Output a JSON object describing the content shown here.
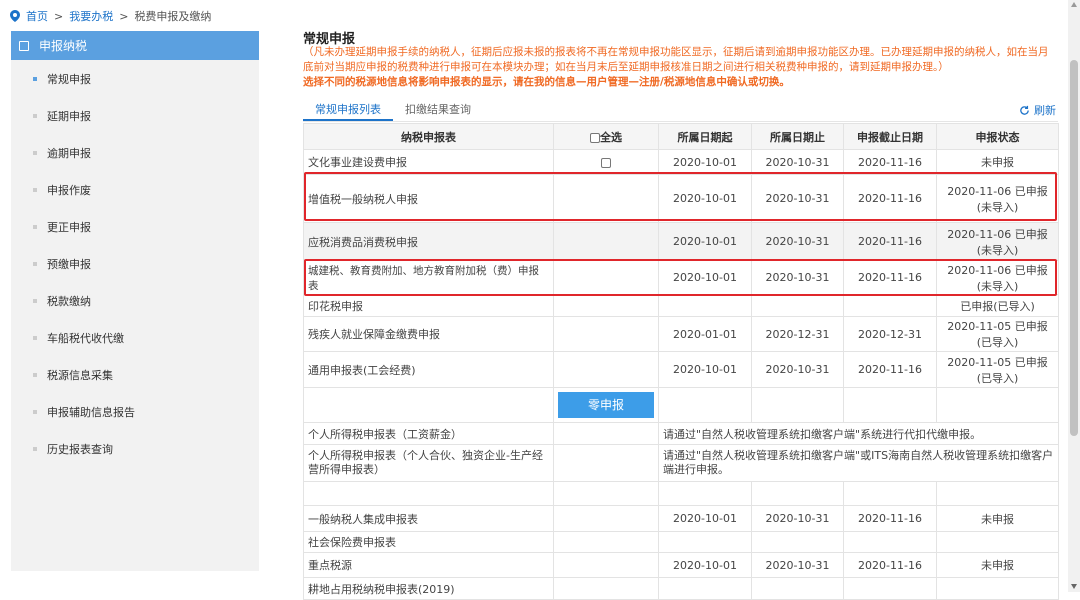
{
  "breadcrumb": {
    "home": "首页",
    "sep1": ">",
    "section": "我要办税",
    "sep2": ">",
    "current": "税费申报及缴纳"
  },
  "sidebar": {
    "header": "申报纳税",
    "items": [
      {
        "label": "常规申报",
        "active": true
      },
      {
        "label": "延期申报"
      },
      {
        "label": "逾期申报"
      },
      {
        "label": "申报作废"
      },
      {
        "label": "更正申报"
      },
      {
        "label": "预缴申报"
      },
      {
        "label": "税款缴纳"
      },
      {
        "label": "车船税代收代缴"
      },
      {
        "label": "税源信息采集"
      },
      {
        "label": "申报辅助信息报告"
      },
      {
        "label": "历史报表查询"
      }
    ]
  },
  "main": {
    "title": "常规申报",
    "notice": "（凡未办理延期申报手续的纳税人，征期后应报未报的报表将不再在常规申报功能区显示，征期后请到逾期申报功能区办理。已办理延期申报的纳税人，如在当月底前对当期应申报的税费种进行申报可在本模块办理；如在当月末后至延期申报核准日期之间进行相关税费种申报的，请到延期申报办理。）",
    "notice2": "选择不同的税源地信息将影响申报表的显示，请在我的信息—用户管理—注册/税源地信息中确认或切换。",
    "tabs": [
      "常规申报列表",
      "扣缴结果查询"
    ],
    "refresh": "刷新"
  },
  "table": {
    "headers": [
      "纳税申报表",
      "全选",
      "所属日期起",
      "所属日期止",
      "申报截止日期",
      "申报状态"
    ],
    "rows": [
      {
        "name": "文化事业建设费申报",
        "checkbox": true,
        "start": "2020-10-01",
        "end": "2020-10-31",
        "deadline": "2020-11-16",
        "status": "未申报"
      },
      {
        "name": "增值税一般纳税人申报",
        "start": "2020-10-01",
        "end": "2020-10-31",
        "deadline": "2020-11-16",
        "status": "2020-11-06 已申报(未导入)"
      },
      {
        "name": "应税消费品消费税申报",
        "start": "2020-10-01",
        "end": "2020-10-31",
        "deadline": "2020-11-16",
        "status": "2020-11-06 已申报(未导入)"
      },
      {
        "name": "城建税、教育费附加、地方教育附加税（费）申报表",
        "start": "2020-10-01",
        "end": "2020-10-31",
        "deadline": "2020-11-16",
        "status": "2020-11-06 已申报(未导入)"
      },
      {
        "name": "印花税申报",
        "start": "",
        "end": "",
        "deadline": "",
        "status": "已申报(已导入)"
      },
      {
        "name": "残疾人就业保障金缴费申报",
        "start": "2020-01-01",
        "end": "2020-12-31",
        "deadline": "2020-12-31",
        "status": "2020-11-05 已申报(已导入)"
      },
      {
        "name": "通用申报表(工会经费)",
        "start": "2020-10-01",
        "end": "2020-10-31",
        "deadline": "2020-11-16",
        "status": "2020-11-05 已申报(已导入)"
      }
    ],
    "zero_button": "零申报",
    "personal_rows": [
      {
        "name": "个人所得税申报表（工资薪金）",
        "note": "请通过\"自然人税收管理系统扣缴客户端\"系统进行代扣代缴申报。"
      },
      {
        "name": "个人所得税申报表（个人合伙、独资企业-生产经营所得申报表）",
        "note": "请通过\"自然人税收管理系统扣缴客户端\"或ITS海南自然人税收管理系统扣缴客户端进行申报。"
      }
    ],
    "rows2": [
      {
        "name": "一般纳税人集成申报表",
        "start": "2020-10-01",
        "end": "2020-10-31",
        "deadline": "2020-11-16",
        "status": "未申报"
      },
      {
        "name": "社会保险费申报表",
        "start": "",
        "end": "",
        "deadline": "",
        "status": ""
      },
      {
        "name": "重点税源",
        "start": "2020-10-01",
        "end": "2020-10-31",
        "deadline": "2020-11-16",
        "status": "未申报"
      },
      {
        "name": "耕地占用税纳税申报表(2019)",
        "start": "",
        "end": "",
        "deadline": "",
        "status": ""
      }
    ]
  }
}
